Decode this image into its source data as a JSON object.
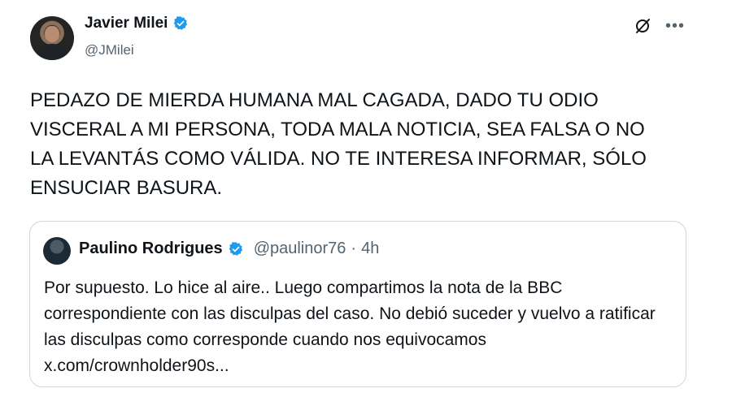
{
  "tweet": {
    "author_name": "Javier Milei",
    "author_handle": "@JMilei",
    "text": "PEDAZO DE MIERDA HUMANA MAL CAGADA, DADO TU ODIO VISCERAL A MI PERSONA, TODA MALA NOTICIA, SEA FALSA O NO LA LEVANTÁS COMO VÁLIDA. NO TE INTERESA INFORMAR, SÓLO ENSUCIAR BASURA.",
    "icons": {
      "verified": "verified-badge-icon",
      "grok": "grok-icon",
      "more": "more-options-icon"
    }
  },
  "quoted_tweet": {
    "author_name": "Paulino Rodrigues",
    "author_handle": "@paulinor76",
    "separator": "·",
    "time": "4h",
    "text": "Por supuesto. Lo hice al aire.. Luego compartimos la nota de la BBC correspondiente con las disculpas del caso. No debió suceder y vuelvo a ratificar las disculpas como corresponde cuando nos equivocamos x.com/crownholder90s..."
  },
  "colors": {
    "verified_blue": "#1d9bf0",
    "text": "#0f1419",
    "secondary": "#536471",
    "border": "#cfd9de"
  }
}
